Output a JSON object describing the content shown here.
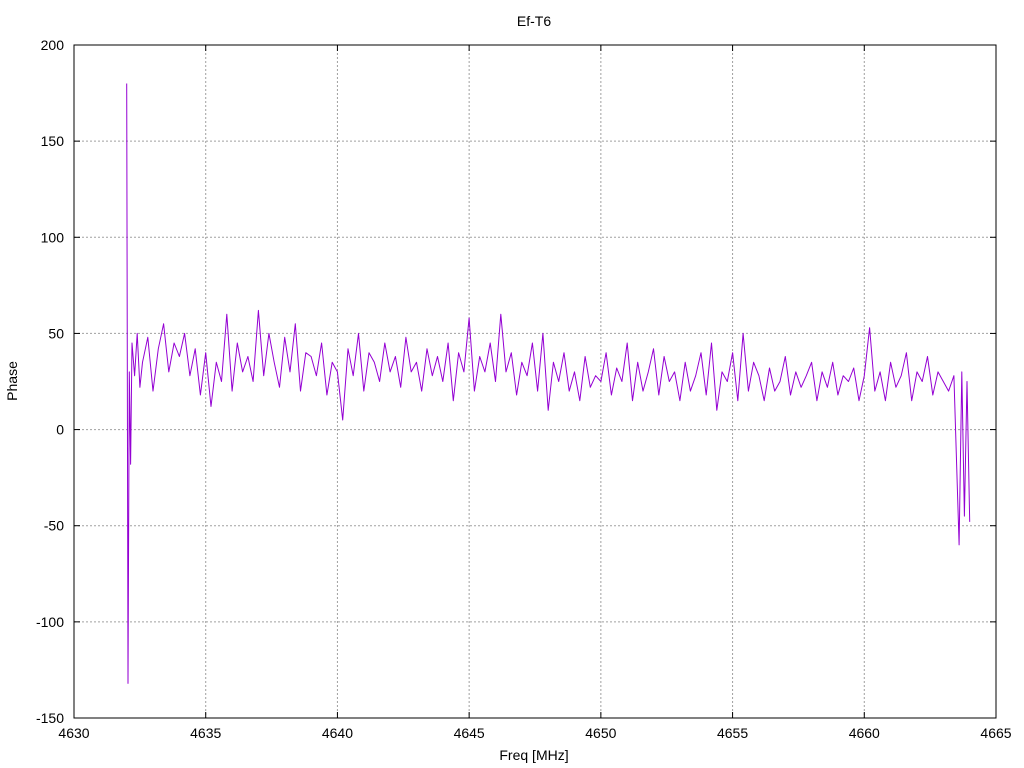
{
  "chart_data": {
    "type": "line",
    "title": "Ef-T6",
    "xlabel": "Freq [MHz]",
    "ylabel": "Phase",
    "xlim": [
      4630,
      4665
    ],
    "ylim": [
      -150,
      200
    ],
    "x_ticks": [
      4630,
      4635,
      4640,
      4645,
      4650,
      4655,
      4660,
      4665
    ],
    "y_ticks": [
      -150,
      -100,
      -50,
      0,
      50,
      100,
      150,
      200
    ],
    "x_tick_labels": [
      "4630",
      "4635",
      "4640",
      "4645",
      "4650",
      "4655",
      "4660",
      "4665"
    ],
    "y_tick_labels": [
      "-150",
      "-100",
      "-50",
      "0",
      "50",
      "100",
      "150",
      "200"
    ],
    "grid": true,
    "legend": "none",
    "series": [
      {
        "color": "#9400d3",
        "x": [
          4632.0,
          4632.05,
          4632.1,
          4632.15,
          4632.2,
          4632.3,
          4632.4,
          4632.5,
          4632.6,
          4632.8,
          4633.0,
          4633.2,
          4633.4,
          4633.6,
          4633.8,
          4634.0,
          4634.2,
          4634.4,
          4634.6,
          4634.8,
          4635.0,
          4635.2,
          4635.4,
          4635.6,
          4635.8,
          4636.0,
          4636.2,
          4636.4,
          4636.6,
          4636.8,
          4637.0,
          4637.2,
          4637.4,
          4637.6,
          4637.8,
          4638.0,
          4638.2,
          4638.4,
          4638.6,
          4638.8,
          4639.0,
          4639.2,
          4639.4,
          4639.6,
          4639.8,
          4640.0,
          4640.2,
          4640.4,
          4640.6,
          4640.8,
          4641.0,
          4641.2,
          4641.4,
          4641.6,
          4641.8,
          4642.0,
          4642.2,
          4642.4,
          4642.6,
          4642.8,
          4643.0,
          4643.2,
          4643.4,
          4643.6,
          4643.8,
          4644.0,
          4644.2,
          4644.4,
          4644.6,
          4644.8,
          4645.0,
          4645.2,
          4645.4,
          4645.6,
          4645.8,
          4646.0,
          4646.2,
          4646.4,
          4646.6,
          4646.8,
          4647.0,
          4647.2,
          4647.4,
          4647.6,
          4647.8,
          4648.0,
          4648.2,
          4648.4,
          4648.6,
          4648.8,
          4649.0,
          4649.2,
          4649.4,
          4649.6,
          4649.8,
          4650.0,
          4650.2,
          4650.4,
          4650.6,
          4650.8,
          4651.0,
          4651.2,
          4651.4,
          4651.6,
          4651.8,
          4652.0,
          4652.2,
          4652.4,
          4652.6,
          4652.8,
          4653.0,
          4653.2,
          4653.4,
          4653.6,
          4653.8,
          4654.0,
          4654.2,
          4654.4,
          4654.6,
          4654.8,
          4655.0,
          4655.2,
          4655.4,
          4655.6,
          4655.8,
          4656.0,
          4656.2,
          4656.4,
          4656.6,
          4656.8,
          4657.0,
          4657.2,
          4657.4,
          4657.6,
          4657.8,
          4658.0,
          4658.2,
          4658.4,
          4658.6,
          4658.8,
          4659.0,
          4659.2,
          4659.4,
          4659.6,
          4659.8,
          4660.0,
          4660.2,
          4660.4,
          4660.6,
          4660.8,
          4661.0,
          4661.2,
          4661.4,
          4661.6,
          4661.8,
          4662.0,
          4662.2,
          4662.4,
          4662.6,
          4662.8,
          4663.0,
          4663.2,
          4663.4,
          4663.6,
          4663.7,
          4663.8,
          4663.9,
          4664.0
        ],
        "y": [
          180,
          -132,
          30,
          -18,
          45,
          28,
          50,
          22,
          35,
          48,
          20,
          42,
          55,
          30,
          45,
          38,
          50,
          28,
          42,
          18,
          40,
          12,
          35,
          25,
          60,
          20,
          45,
          30,
          38,
          25,
          62,
          28,
          50,
          35,
          22,
          48,
          30,
          55,
          20,
          40,
          38,
          28,
          45,
          18,
          35,
          30,
          5,
          42,
          28,
          50,
          20,
          40,
          35,
          25,
          45,
          30,
          38,
          22,
          48,
          30,
          35,
          20,
          42,
          28,
          38,
          25,
          45,
          15,
          40,
          30,
          58,
          20,
          38,
          30,
          45,
          25,
          60,
          30,
          40,
          18,
          35,
          28,
          45,
          20,
          50,
          10,
          35,
          25,
          40,
          20,
          30,
          15,
          38,
          22,
          28,
          25,
          40,
          18,
          32,
          25,
          45,
          15,
          35,
          20,
          30,
          42,
          18,
          38,
          25,
          30,
          15,
          35,
          20,
          28,
          40,
          18,
          45,
          10,
          30,
          25,
          40,
          15,
          50,
          20,
          35,
          28,
          15,
          32,
          20,
          25,
          38,
          18,
          30,
          22,
          28,
          35,
          15,
          30,
          22,
          35,
          18,
          28,
          25,
          32,
          15,
          28,
          53,
          20,
          30,
          15,
          35,
          22,
          28,
          40,
          15,
          30,
          25,
          38,
          18,
          30,
          25,
          20,
          28,
          -60,
          30,
          -45,
          25,
          -48
        ]
      }
    ]
  }
}
